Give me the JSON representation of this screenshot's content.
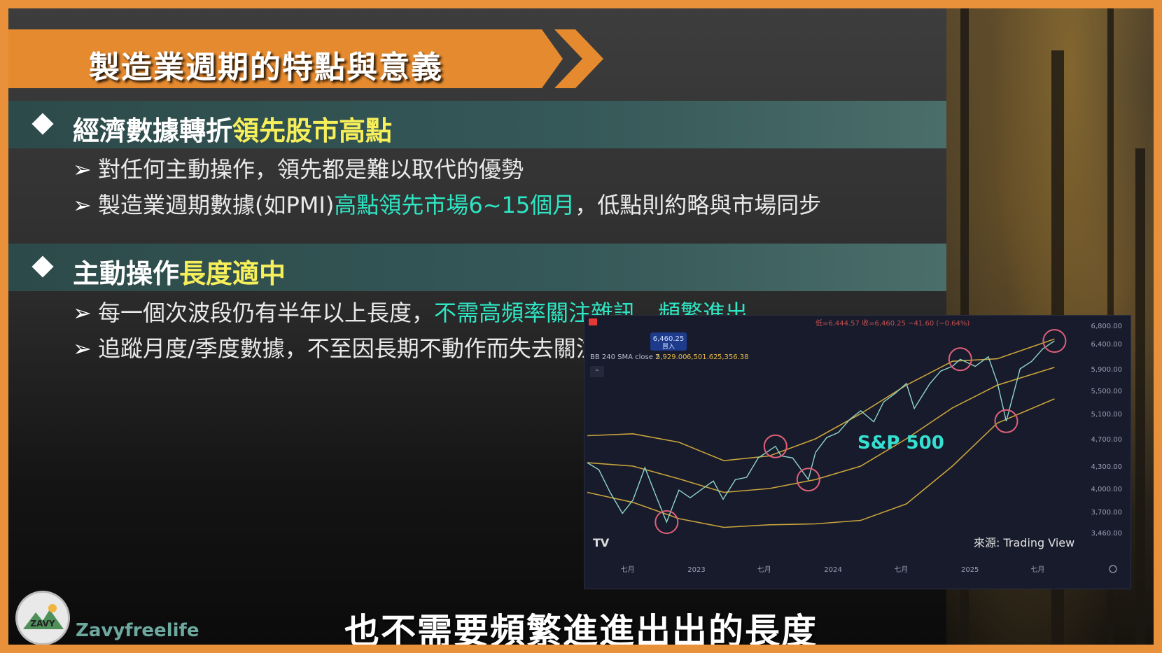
{
  "title": "製造業週期的特點與意義",
  "sections": [
    {
      "prefix": "經濟數據轉折",
      "highlight": "領先股市高點",
      "bullets": [
        {
          "parts": [
            {
              "text": "對任何主動操作，領先都是難以取代的優勢",
              "style": "normal"
            }
          ]
        },
        {
          "parts": [
            {
              "text": "製造業週期數據(如PMI)",
              "style": "normal"
            },
            {
              "text": "高點領先市場6~15個月",
              "style": "cyan"
            },
            {
              "text": "，低點則約略與市場同步",
              "style": "normal"
            }
          ]
        }
      ]
    },
    {
      "prefix": "主動操作",
      "highlight": "長度適中",
      "bullets": [
        {
          "parts": [
            {
              "text": "每一個次波段仍有半年以上長度，",
              "style": "normal"
            },
            {
              "text": "不需高頻率關注雜訊、頻繁進出",
              "style": "cyan"
            }
          ]
        },
        {
          "parts": [
            {
              "text": "追蹤月度/季度數據，不至因長期不動作而失去關注",
              "style": "normal"
            }
          ]
        }
      ]
    }
  ],
  "chart_data": {
    "type": "line",
    "series_label": "S&P 500",
    "indicator_label": "BB 240 SMA close 2",
    "indicator_values": [
      "5,929.00",
      "6,501.62",
      "5,356.38"
    ],
    "header_info": "低=6,444.57  收=6,460.25  −41.60 (−0.64%)",
    "price_box": "6,460.25",
    "price_box_sub": "買入",
    "source": "來源: Trading View",
    "x_ticks": [
      "七月",
      "2023",
      "七月",
      "2024",
      "七月",
      "2025",
      "七月"
    ],
    "y_ticks": [
      "6,800.00",
      "6,400.00",
      "5,900.00",
      "5,500.00",
      "5,100.00",
      "4,700.00",
      "4,300.00",
      "4,000.00",
      "3,700.00",
      "3,460.00"
    ],
    "price": [
      [
        "2022-03-15",
        4350
      ],
      [
        "2022-04-15",
        4250
      ],
      [
        "2022-05-15",
        3950
      ],
      [
        "2022-06-17",
        3680
      ],
      [
        "2022-07-15",
        3850
      ],
      [
        "2022-08-16",
        4280
      ],
      [
        "2022-09-15",
        3900
      ],
      [
        "2022-10-13",
        3580
      ],
      [
        "2022-11-15",
        3980
      ],
      [
        "2022-12-15",
        3880
      ],
      [
        "2023-01-15",
        3990
      ],
      [
        "2023-02-15",
        4100
      ],
      [
        "2023-03-13",
        3860
      ],
      [
        "2023-04-15",
        4120
      ],
      [
        "2023-05-15",
        4150
      ],
      [
        "2023-06-15",
        4420
      ],
      [
        "2023-07-31",
        4590
      ],
      [
        "2023-08-15",
        4450
      ],
      [
        "2023-09-15",
        4420
      ],
      [
        "2023-10-27",
        4120
      ],
      [
        "2023-11-15",
        4500
      ],
      [
        "2023-12-15",
        4720
      ],
      [
        "2024-01-15",
        4800
      ],
      [
        "2024-02-15",
        5010
      ],
      [
        "2024-03-15",
        5150
      ],
      [
        "2024-04-19",
        4970
      ],
      [
        "2024-05-15",
        5300
      ],
      [
        "2024-06-15",
        5450
      ],
      [
        "2024-07-15",
        5630
      ],
      [
        "2024-08-05",
        5190
      ],
      [
        "2024-09-15",
        5620
      ],
      [
        "2024-10-15",
        5860
      ],
      [
        "2024-11-15",
        5950
      ],
      [
        "2024-12-06",
        6090
      ],
      [
        "2025-01-15",
        5950
      ],
      [
        "2025-02-19",
        6140
      ],
      [
        "2025-03-15",
        5650
      ],
      [
        "2025-04-08",
        4980
      ],
      [
        "2025-05-15",
        5900
      ],
      [
        "2025-06-15",
        6050
      ],
      [
        "2025-07-15",
        6300
      ],
      [
        "2025-08-15",
        6460
      ]
    ],
    "bb_middle": [
      [
        "2022-03-15",
        4350
      ],
      [
        "2022-07-15",
        4300
      ],
      [
        "2022-11-15",
        4130
      ],
      [
        "2023-03-15",
        3950
      ],
      [
        "2023-07-15",
        4000
      ],
      [
        "2023-11-15",
        4120
      ],
      [
        "2024-03-15",
        4300
      ],
      [
        "2024-07-15",
        4700
      ],
      [
        "2024-11-15",
        5200
      ],
      [
        "2025-03-15",
        5600
      ],
      [
        "2025-08-15",
        5929
      ]
    ],
    "bb_upper": [
      [
        "2022-03-15",
        4750
      ],
      [
        "2022-07-15",
        4780
      ],
      [
        "2022-11-15",
        4650
      ],
      [
        "2023-03-15",
        4380
      ],
      [
        "2023-07-15",
        4450
      ],
      [
        "2023-11-15",
        4700
      ],
      [
        "2024-03-15",
        5100
      ],
      [
        "2024-07-15",
        5600
      ],
      [
        "2024-11-15",
        6050
      ],
      [
        "2025-03-15",
        6100
      ],
      [
        "2025-08-15",
        6501
      ]
    ],
    "bb_lower": [
      [
        "2022-03-15",
        3950
      ],
      [
        "2022-07-15",
        3820
      ],
      [
        "2022-11-15",
        3620
      ],
      [
        "2023-03-15",
        3520
      ],
      [
        "2023-07-15",
        3550
      ],
      [
        "2023-11-15",
        3560
      ],
      [
        "2024-03-15",
        3600
      ],
      [
        "2024-07-15",
        3800
      ],
      [
        "2024-11-15",
        4300
      ],
      [
        "2025-03-15",
        4950
      ],
      [
        "2025-08-15",
        5356
      ]
    ],
    "marked_points": [
      [
        "2022-10-13",
        3580
      ],
      [
        "2023-07-31",
        4590
      ],
      [
        "2023-10-27",
        4120
      ],
      [
        "2024-12-06",
        6090
      ],
      [
        "2025-04-08",
        4980
      ],
      [
        "2025-08-15",
        6460
      ]
    ]
  },
  "caption": "也不需要頻繁進進出出的長度",
  "logo": {
    "text": "ZAVY",
    "channel": "Zavyfreelife"
  },
  "colors": {
    "accent": "#e58a2f",
    "highlight_yellow": "#f6ef5a",
    "highlight_cyan": "#2ee6c4",
    "circle": "#e0607a",
    "band": "#c9a33c"
  }
}
